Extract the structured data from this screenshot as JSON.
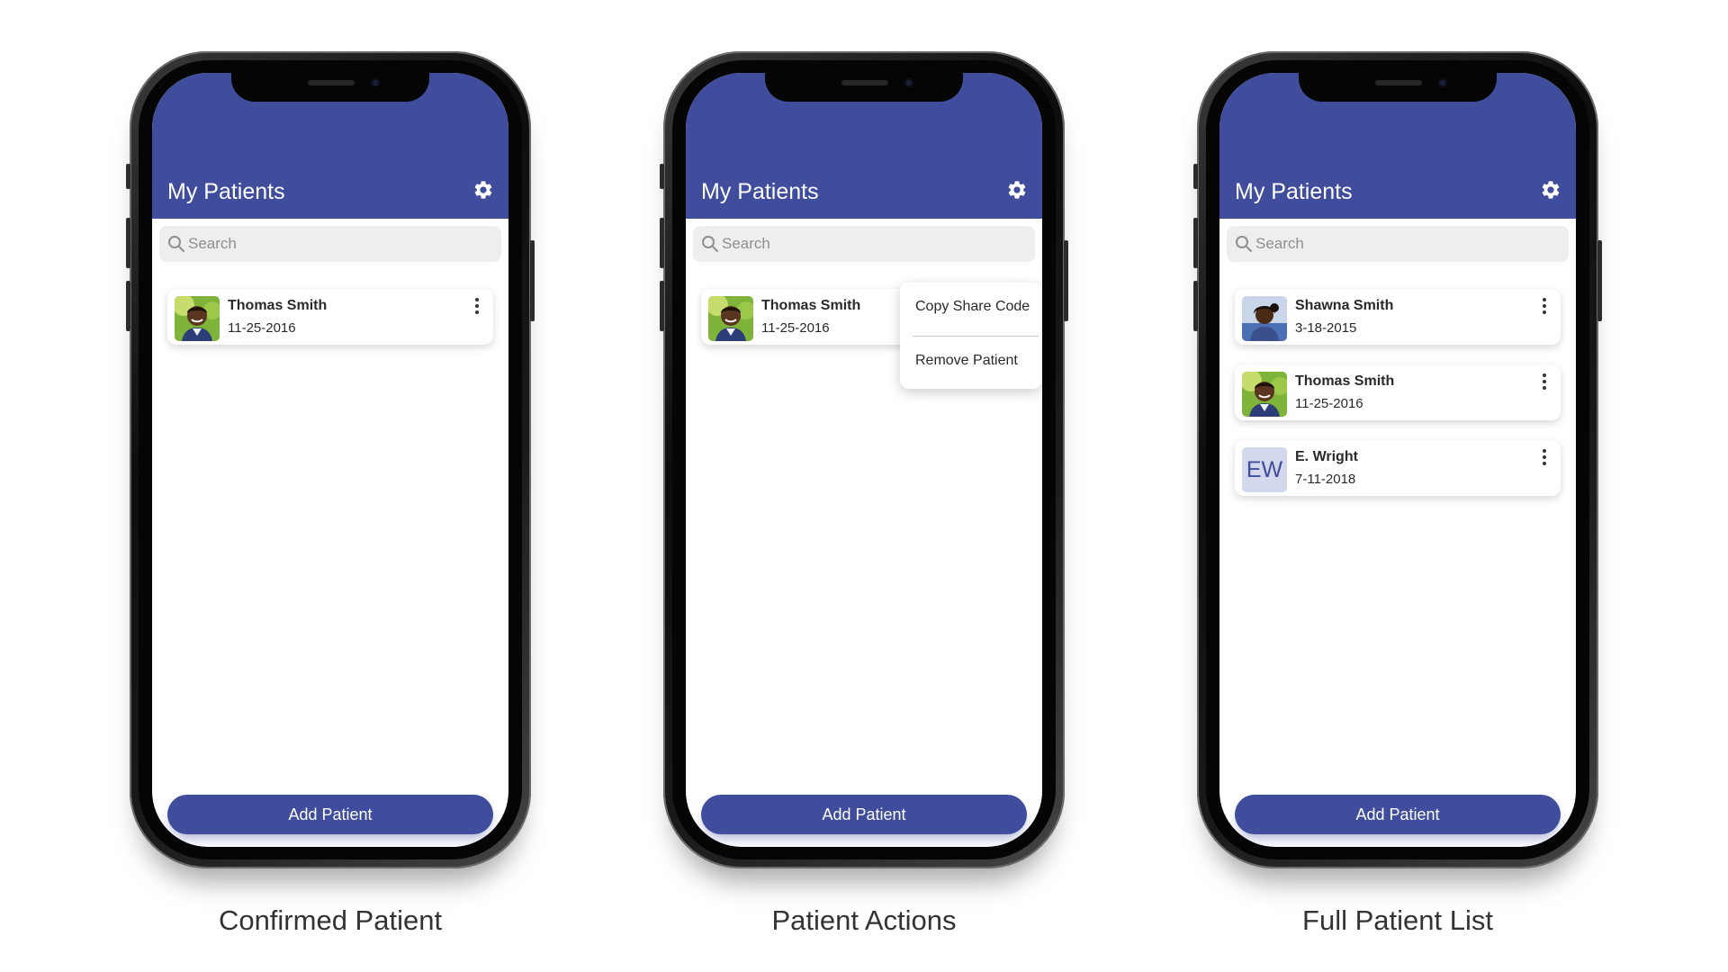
{
  "colors": {
    "brand": "#3f4d9c",
    "appbar_text": "#ffffff",
    "search_bg": "#eeeeee",
    "initials_bg": "#d4d8ec"
  },
  "icons": {
    "settings": "gear-icon",
    "search": "search-icon",
    "more": "more-vertical-icon"
  },
  "phones": [
    {
      "caption": "Confirmed Patient",
      "title": "My Patients",
      "search_placeholder": "Search",
      "patients": [
        {
          "name": "Thomas Smith",
          "dob": "11-25-2016",
          "avatar": "photo"
        }
      ],
      "add_button": "Add Patient"
    },
    {
      "caption": "Patient Actions",
      "title": "My Patients",
      "search_placeholder": "Search",
      "patients": [
        {
          "name": "Thomas Smith",
          "dob": "11-25-2016",
          "avatar": "photo"
        }
      ],
      "menu": [
        "Copy Share Code",
        "Remove Patient"
      ],
      "add_button": "Add Patient"
    },
    {
      "caption": "Full Patient List",
      "title": "My Patients",
      "search_placeholder": "Search",
      "patients": [
        {
          "name": "Shawna Smith",
          "dob": "3-18-2015",
          "avatar": "photo"
        },
        {
          "name": "Thomas Smith",
          "dob": "11-25-2016",
          "avatar": "photo"
        },
        {
          "name": "E. Wright",
          "dob": "7-11-2018",
          "avatar": "initials",
          "initials": "EW"
        }
      ],
      "add_button": "Add Patient"
    }
  ]
}
